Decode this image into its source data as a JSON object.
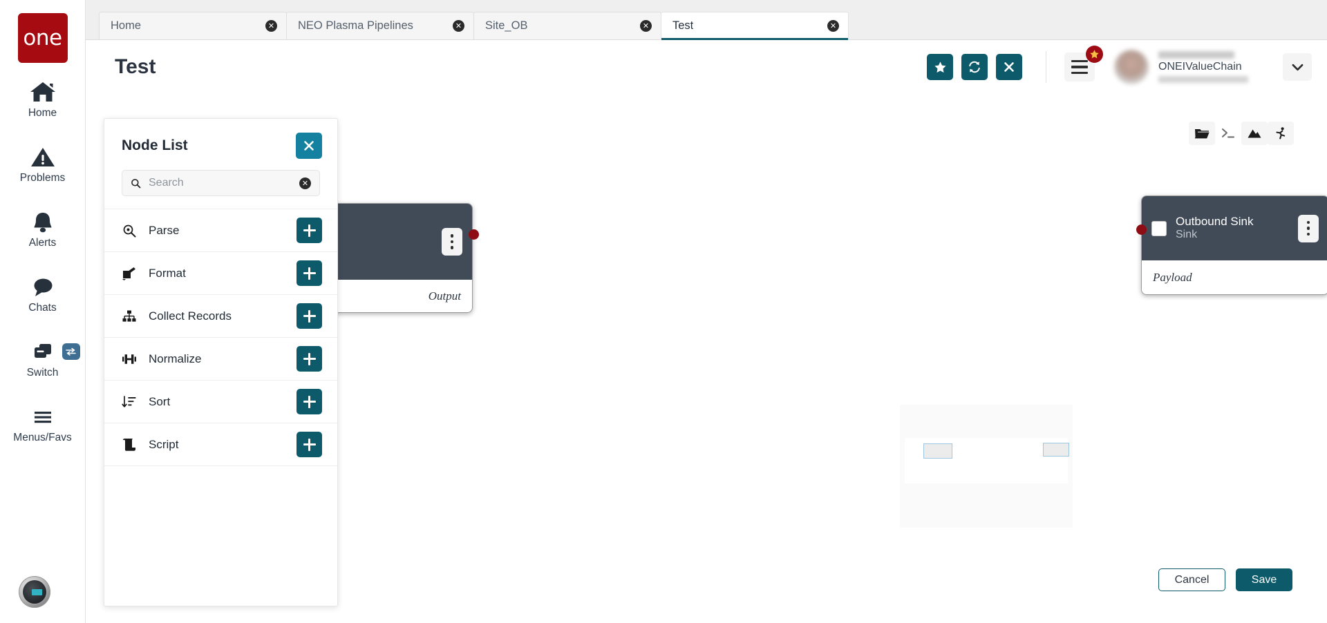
{
  "brand": {
    "logo_text": "one",
    "accent": "#0d5a6b",
    "logo_bg": "#a60b12"
  },
  "rail": {
    "items": [
      {
        "label": "Home",
        "icon": "home-icon"
      },
      {
        "label": "Problems",
        "icon": "warning-triangle-icon"
      },
      {
        "label": "Alerts",
        "icon": "bell-icon"
      },
      {
        "label": "Chats",
        "icon": "chat-bubble-icon"
      },
      {
        "label": "Switch",
        "icon": "windows-stack-icon",
        "badge_icon": "swap-arrows-icon"
      },
      {
        "label": "Menus/Favs",
        "icon": "hamburger-icon"
      }
    ],
    "assistant_avatar": "ai-assistant-avatar"
  },
  "tabs": [
    {
      "label": "Home",
      "active": false
    },
    {
      "label": "NEO Plasma Pipelines",
      "active": false
    },
    {
      "label": "Site_OB",
      "active": false
    },
    {
      "label": "Test",
      "active": true
    }
  ],
  "header": {
    "title": "Test",
    "actions": [
      {
        "name": "favorite-button",
        "icon": "star-icon"
      },
      {
        "name": "refresh-button",
        "icon": "refresh-icon"
      },
      {
        "name": "close-button",
        "icon": "x-icon"
      }
    ],
    "menu_button": {
      "icon": "hamburger-icon",
      "badge_icon": "star-icon"
    },
    "user": {
      "org": "ONEIValueChain",
      "caret": "chevron-down-icon"
    }
  },
  "node_list": {
    "title": "Node List",
    "close_label": "×",
    "search": {
      "placeholder": "Search",
      "value": "",
      "icon": "search-icon",
      "clear_icon": "clear-icon"
    },
    "items": [
      {
        "label": "Parse",
        "icon": "magnifier-doc-icon",
        "add_label": "+"
      },
      {
        "label": "Format",
        "icon": "edit-document-icon",
        "add_label": "+"
      },
      {
        "label": "Collect Records",
        "icon": "hierarchy-icon",
        "add_label": "+"
      },
      {
        "label": "Normalize",
        "icon": "equalizer-icon",
        "add_label": "+"
      },
      {
        "label": "Sort",
        "icon": "sort-descending-icon",
        "add_label": "+"
      },
      {
        "label": "Script",
        "icon": "scroll-script-icon",
        "add_label": "+"
      }
    ]
  },
  "canvas": {
    "tools": [
      {
        "name": "open-folder-icon",
        "shaded": true
      },
      {
        "name": "terminal-icon",
        "shaded": false
      },
      {
        "name": "image-icon",
        "shaded": true
      },
      {
        "name": "run-icon",
        "shaded": true
      }
    ],
    "nodes": [
      {
        "title": "",
        "subtitle": "",
        "port_label": "Output",
        "port_side": "right",
        "partially_hidden": true
      },
      {
        "title": "Outbound Sink",
        "subtitle": "Sink",
        "port_label": "Payload",
        "port_side": "left",
        "partially_hidden": false
      }
    ],
    "minimap": {
      "node_count": 2
    }
  },
  "footer": {
    "cancel_label": "Cancel",
    "save_label": "Save"
  }
}
